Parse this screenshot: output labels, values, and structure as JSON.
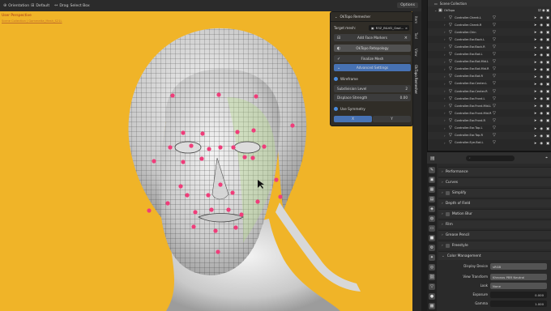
{
  "viewport": {
    "header": {
      "orientation_label": "Orientation",
      "orientation_value": "Default",
      "drag_label": "Drag",
      "drag_value": "Select Box",
      "options_label": "Options"
    },
    "overlay": {
      "view_name": "User Perspective",
      "collection_path": "Scene Collection | Gammetta_Mesh_S21L"
    },
    "nav_tabs": [
      "Item",
      "Tool",
      "View",
      "OkTopo Remesher"
    ]
  },
  "oktopo_panel": {
    "title": "OkTopo Remesher",
    "target_mesh_label": "Target mesh:",
    "target_mesh_value": "R3Z_B&VD_Gwd...",
    "add_face_markers": "Add Face Markers",
    "retopology_button": "OkTopo Retopology",
    "finalize_mesh": "Finalize Mesh",
    "advanced_settings": "Advanced Settings",
    "wireframe_label": "Wireframe",
    "subdivision_level_label": "Subdivision Level",
    "subdivision_level_value": "2",
    "displace_strength_label": "Displace Strength",
    "displace_strength_value": "0.00",
    "use_symmetry_label": "Use Symmetry",
    "x_label": "X",
    "y_label": "Y"
  },
  "outliner": {
    "root": "Scene Collection",
    "collection": "OkTopo",
    "items": [
      "Controller.Cheek.L",
      "Controller.Cheek.R",
      "Controller.Chin",
      "Controller.Ear.Back.L",
      "Controller.Ear.Back.R",
      "Controller.Ear.Bot.L",
      "Controller.Ear.Bot.Mid.L",
      "Controller.Ear.Bot.Mid.R",
      "Controller.Ear.Bot.R",
      "Controller.Ear.Center.L",
      "Controller.Ear.Center.R",
      "Controller.Ear.Front.L",
      "Controller.Ear.Front.Mid.L",
      "Controller.Ear.Front.Mid.R",
      "Controller.Ear.Front.R",
      "Controller.Ear.Top.L",
      "Controller.Ear.Top.R",
      "Controller.Eye.Bot.L"
    ]
  },
  "properties": {
    "search_placeholder": "",
    "sections": {
      "performance": "Performance",
      "curves": "Curves",
      "simplify": "Simplify",
      "depth_of_field": "Depth of Field",
      "motion_blur": "Motion Blur",
      "film": "Film",
      "grease_pencil": "Grease Pencil",
      "freestyle": "Freestyle",
      "color_management": "Color Management"
    },
    "fields": {
      "display_device_label": "Display Device",
      "display_device_value": "sRGB",
      "view_transform_label": "View Transform",
      "view_transform_value": "Khronos PBR Neutral",
      "look_label": "Look",
      "look_value": "None",
      "exposure_label": "Exposure",
      "exposure_value": "0.000",
      "gamma_label": "Gamma",
      "gamma_value": "1.000"
    }
  },
  "colors": {
    "viewport_bg": "#f0b428",
    "accent_blue": "#4772b3",
    "marker_pink": "#ef3d7a"
  }
}
